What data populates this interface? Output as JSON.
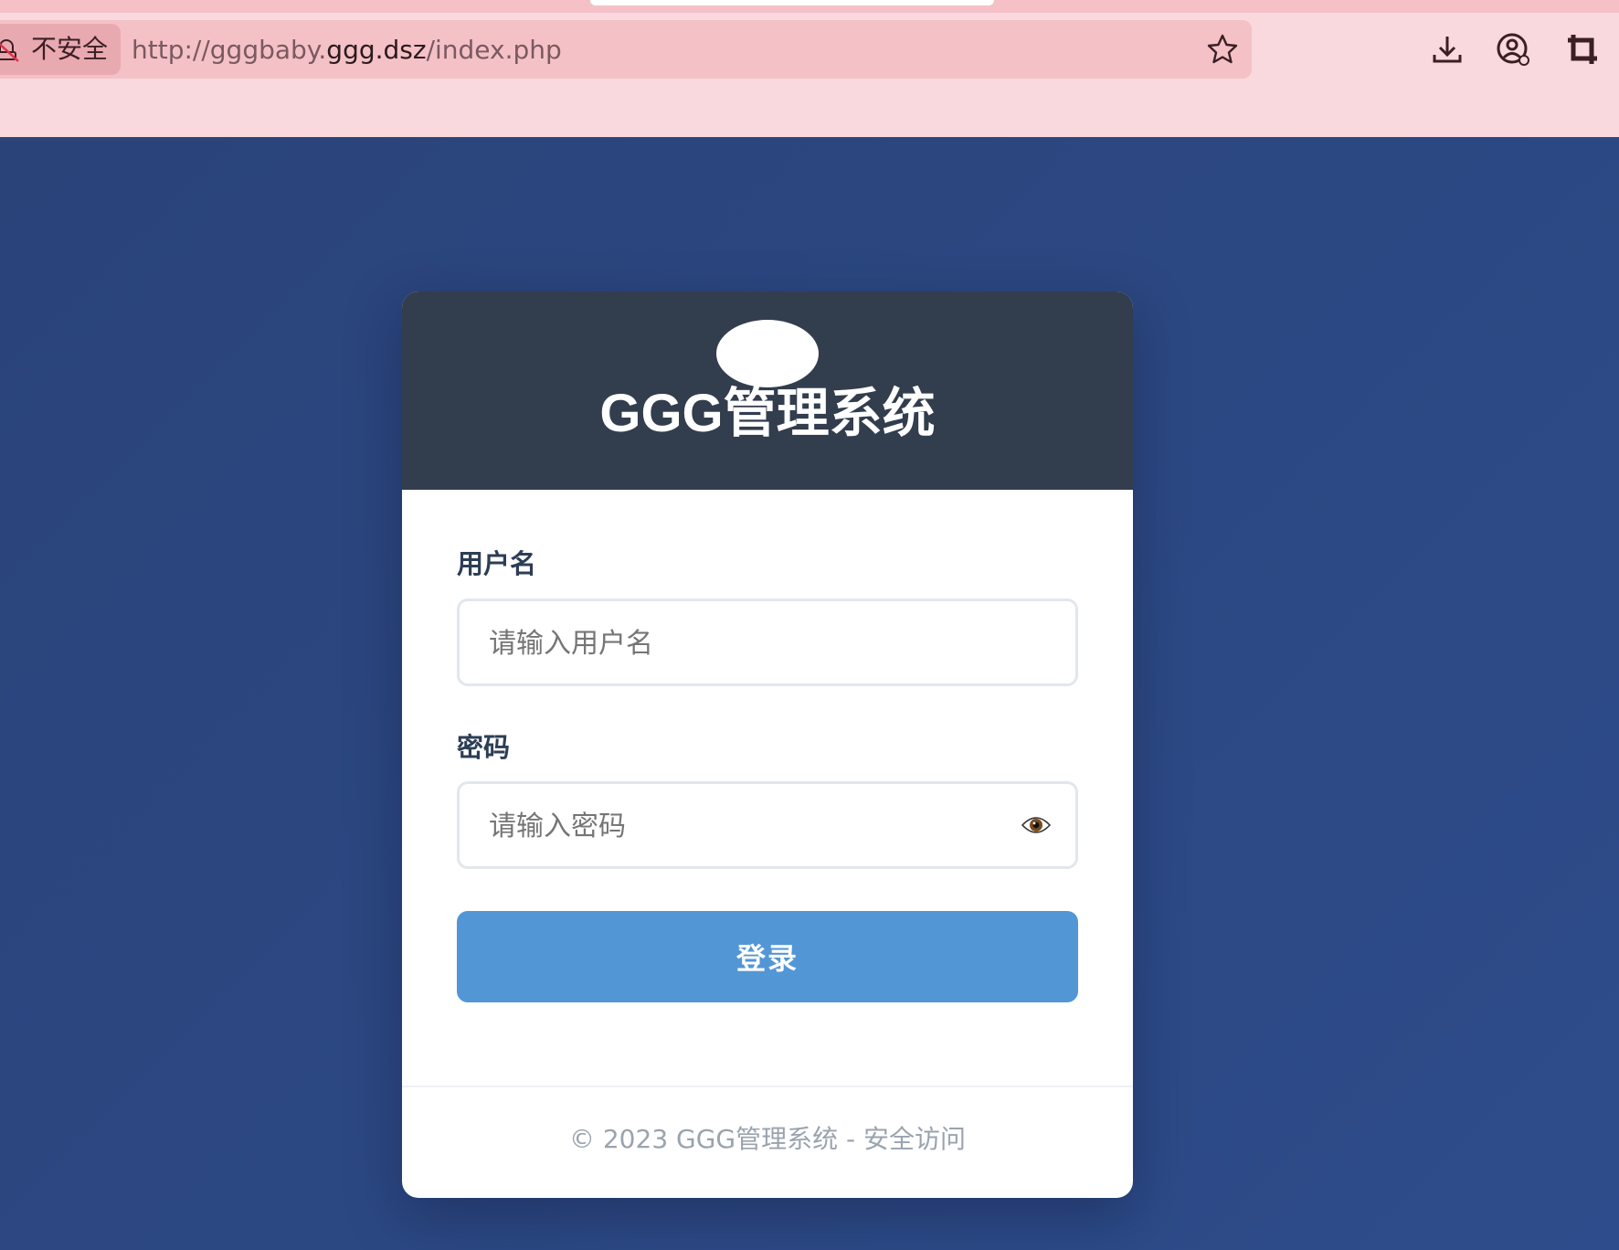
{
  "browser": {
    "security_label": "不安全",
    "url_scheme": "http://",
    "url_subdomain": "gggbaby.",
    "url_host": "ggg.dsz",
    "url_path": "/index.php"
  },
  "login": {
    "title": "GGG管理系统",
    "username_label": "用户名",
    "username_placeholder": "请输入用户名",
    "password_label": "密码",
    "password_placeholder": "请输入密码",
    "submit_label": "登录",
    "footer": "© 2023 GGG管理系统 - 安全访问"
  },
  "colors": {
    "background": "#2b477f",
    "header": "#323d4e",
    "button": "#5296d5",
    "chrome": "#f9d9dd"
  },
  "icons": [
    "not-secure-icon",
    "star-icon",
    "download-icon",
    "profile-icon",
    "crop-icon",
    "eye-icon"
  ]
}
